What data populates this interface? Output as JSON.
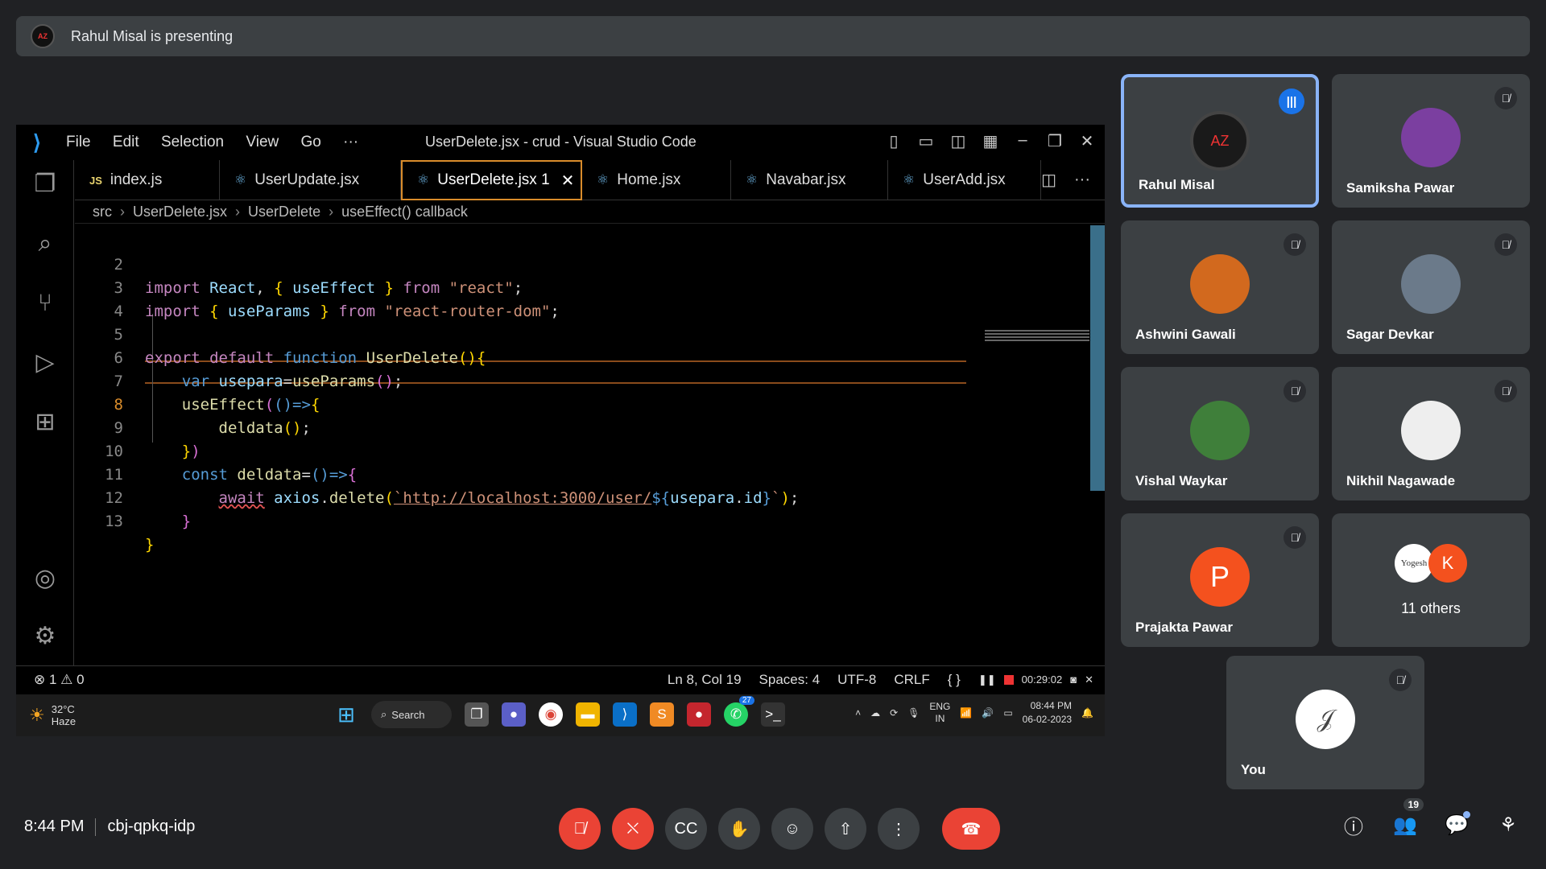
{
  "banner": {
    "avatar_text": "AZ",
    "text": "Rahul Misal is presenting"
  },
  "vscode": {
    "menu": [
      "File",
      "Edit",
      "Selection",
      "View",
      "Go",
      "···"
    ],
    "window_title": "UserDelete.jsx - crud - Visual Studio Code",
    "tabs": [
      {
        "icon": "JS",
        "label": "index.js",
        "active": false
      },
      {
        "icon": "⚛",
        "label": "UserUpdate.jsx",
        "active": false
      },
      {
        "icon": "⚛",
        "label": "UserDelete.jsx 1",
        "active": true
      },
      {
        "icon": "⚛",
        "label": "Home.jsx",
        "active": false
      },
      {
        "icon": "⚛",
        "label": "Navabar.jsx",
        "active": false
      },
      {
        "icon": "⚛",
        "label": "UserAdd.jsx",
        "active": false
      }
    ],
    "breadcrumb": [
      "src",
      "UserDelete.jsx",
      "UserDelete",
      "useEffect() callback"
    ],
    "line_numbers": [
      "2",
      "3",
      "4",
      "5",
      "6",
      "7",
      "8",
      "9",
      "10",
      "11",
      "12",
      "13"
    ],
    "current_line": "8",
    "status": {
      "problems": "⊗ 1 ⚠ 0",
      "position": "Ln 8, Col 19",
      "spaces": "Spaces: 4",
      "encoding": "UTF-8",
      "eol": "CRLF",
      "language": "{ }",
      "recording_time": "00:29:02"
    }
  },
  "taskbar": {
    "temperature": "32°C",
    "weather": "Haze",
    "search": "Search",
    "whatsapp_badge": "27",
    "lang": "ENG",
    "region": "IN",
    "time": "08:44 PM",
    "date": "06-02-2023"
  },
  "participants": [
    {
      "name": "Rahul Misal",
      "speaking": true,
      "avatar": "AZ",
      "color": "#1a1a1a"
    },
    {
      "name": "Samiksha Pawar",
      "speaking": false,
      "avatar": "",
      "color": "#7b3fa0"
    },
    {
      "name": "Ashwini Gawali",
      "speaking": false,
      "avatar": "",
      "color": "#d2691e"
    },
    {
      "name": "Sagar Devkar",
      "speaking": false,
      "avatar": "",
      "color": "#6b7a8a"
    },
    {
      "name": "Vishal Waykar",
      "speaking": false,
      "avatar": "",
      "color": "#3f7f3a"
    },
    {
      "name": "Nikhil Nagawade",
      "speaking": false,
      "avatar": "",
      "color": "#2e2e2e"
    },
    {
      "name": "Prajakta Pawar",
      "speaking": false,
      "avatar": "P",
      "color": "#f4511e"
    }
  ],
  "others": {
    "label": "11 others",
    "avatar1": "Yogesh",
    "avatar2": "K",
    "avatar2_color": "#f4511e"
  },
  "self_tile": {
    "name": "You"
  },
  "meeting": {
    "time": "8:44 PM",
    "code": "cbj-qpkq-idp",
    "people_count": "19"
  },
  "colors": {
    "accent": "#8ab4f8",
    "danger": "#ea4335",
    "tile": "#3c4043",
    "bg": "#202124"
  }
}
